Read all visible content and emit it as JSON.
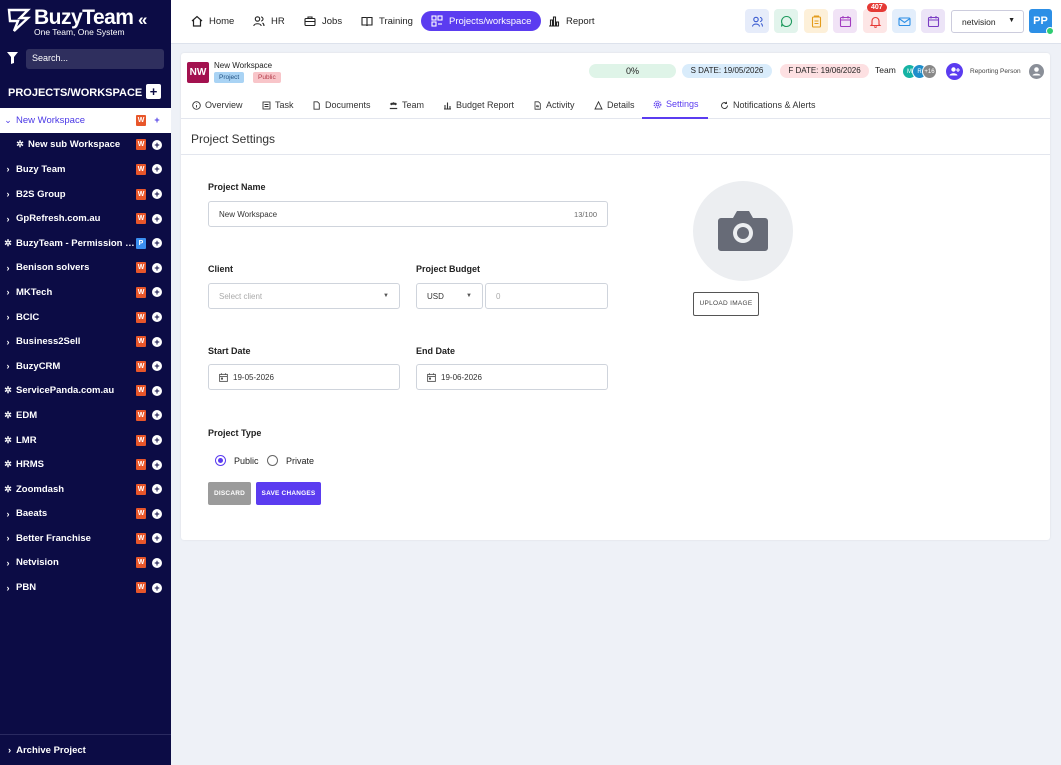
{
  "brand": {
    "name": "BuzyTeam",
    "tagline": "One Team, One System"
  },
  "sidebar": {
    "search_placeholder": "Search...",
    "section_title": "PROJECTS/WORKSPACE",
    "items": [
      {
        "label": "New Workspace",
        "badge": "W",
        "active": true,
        "kind": "chevron-down"
      },
      {
        "label": "New sub Workspace",
        "badge": "W",
        "kind": "sub"
      },
      {
        "label": "Buzy Team",
        "badge": "W",
        "kind": "chevron"
      },
      {
        "label": "B2S Group",
        "badge": "W",
        "kind": "chevron"
      },
      {
        "label": "GpRefresh.com.au",
        "badge": "W",
        "kind": "chevron"
      },
      {
        "label": "BuzyTeam - Permission & S...",
        "badge": "P",
        "kind": "spin"
      },
      {
        "label": "Benison solvers",
        "badge": "W",
        "kind": "chevron"
      },
      {
        "label": "MKTech",
        "badge": "W",
        "kind": "chevron"
      },
      {
        "label": "BCIC",
        "badge": "W",
        "kind": "chevron"
      },
      {
        "label": "Business2Sell",
        "badge": "W",
        "kind": "chevron"
      },
      {
        "label": "BuzyCRM",
        "badge": "W",
        "kind": "chevron"
      },
      {
        "label": "ServicePanda.com.au",
        "badge": "W",
        "kind": "spin"
      },
      {
        "label": "EDM",
        "badge": "W",
        "kind": "spin"
      },
      {
        "label": "LMR",
        "badge": "W",
        "kind": "spin"
      },
      {
        "label": "HRMS",
        "badge": "W",
        "kind": "spin"
      },
      {
        "label": "Zoomdash",
        "badge": "W",
        "kind": "spin"
      },
      {
        "label": "Baeats",
        "badge": "W",
        "kind": "chevron"
      },
      {
        "label": "Better Franchise",
        "badge": "W",
        "kind": "chevron"
      },
      {
        "label": "Netvision",
        "badge": "W",
        "kind": "chevron"
      },
      {
        "label": "PBN",
        "badge": "W",
        "kind": "chevron"
      }
    ],
    "archive": "Archive Project"
  },
  "topnav": {
    "items": [
      "Home",
      "HR",
      "Jobs",
      "Training",
      "Projects/workspace",
      "Report"
    ],
    "notification_count": "407",
    "org": "netvision",
    "user_initials": "PP"
  },
  "project": {
    "initials": "NW",
    "name": "New Workspace",
    "tag_project": "Project",
    "tag_public": "Public",
    "progress": "0%",
    "start_date": "S DATE: 19/05/2026",
    "finish_date": "F DATE: 19/06/2026",
    "team_label": "Team",
    "team_members": [
      "M",
      "R"
    ],
    "team_more": "+16",
    "reporting": "Reporting Person"
  },
  "tabs": [
    "Overview",
    "Task",
    "Documents",
    "Team",
    "Budget Report",
    "Activity",
    "Details",
    "Settings",
    "Notifications & Alerts"
  ],
  "form": {
    "title": "Project Settings",
    "project_name_label": "Project Name",
    "project_name_value": "New Workspace",
    "project_name_counter": "13/100",
    "client_label": "Client",
    "client_placeholder": "Select client",
    "budget_label": "Project Budget",
    "currency": "USD",
    "budget_placeholder": "0",
    "start_label": "Start Date",
    "start_value": "19-05-2026",
    "end_label": "End Date",
    "end_value": "19-06-2026",
    "type_label": "Project Type",
    "type_public": "Public",
    "type_private": "Private",
    "upload_label": "UPLOAD IMAGE",
    "discard": "DISCARD",
    "save": "SAVE CHANGES"
  },
  "colors": {
    "sidebar": "#0c0c45",
    "accent": "#5b3cf0",
    "badge_w": "#e8562a",
    "badge_p": "#3b8ff0"
  }
}
